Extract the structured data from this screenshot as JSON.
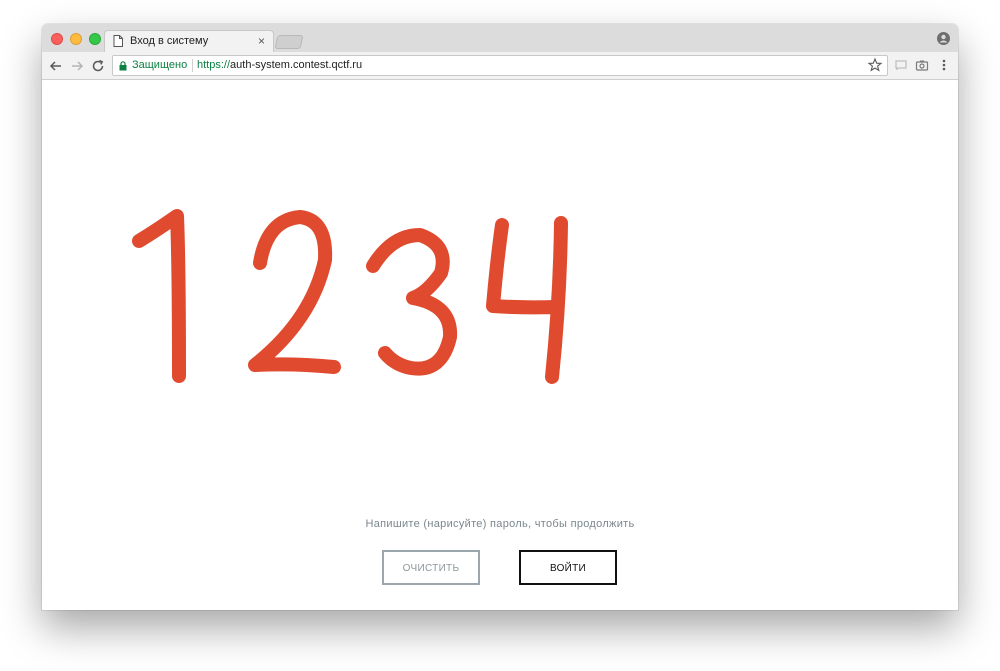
{
  "browser": {
    "tab_title": "Вход в систему",
    "tab_close": "×",
    "secure_label": "Защищено",
    "url_scheme": "https://",
    "url_host": "auth-system.contest.qctf.ru"
  },
  "page": {
    "drawn_password": "1234",
    "drawing_color": "#e04a2f",
    "hint": "Напишите (нарисуйте) пароль, чтобы продолжить",
    "clear_label": "ОЧИСТИТЬ",
    "login_label": "ВОЙТИ"
  },
  "icons": [
    "document-icon",
    "profile-icon",
    "back-arrow-icon",
    "forward-arrow-icon",
    "reload-icon",
    "lock-icon",
    "star-icon",
    "cast-icon",
    "camera-icon",
    "menu-dots-icon"
  ]
}
